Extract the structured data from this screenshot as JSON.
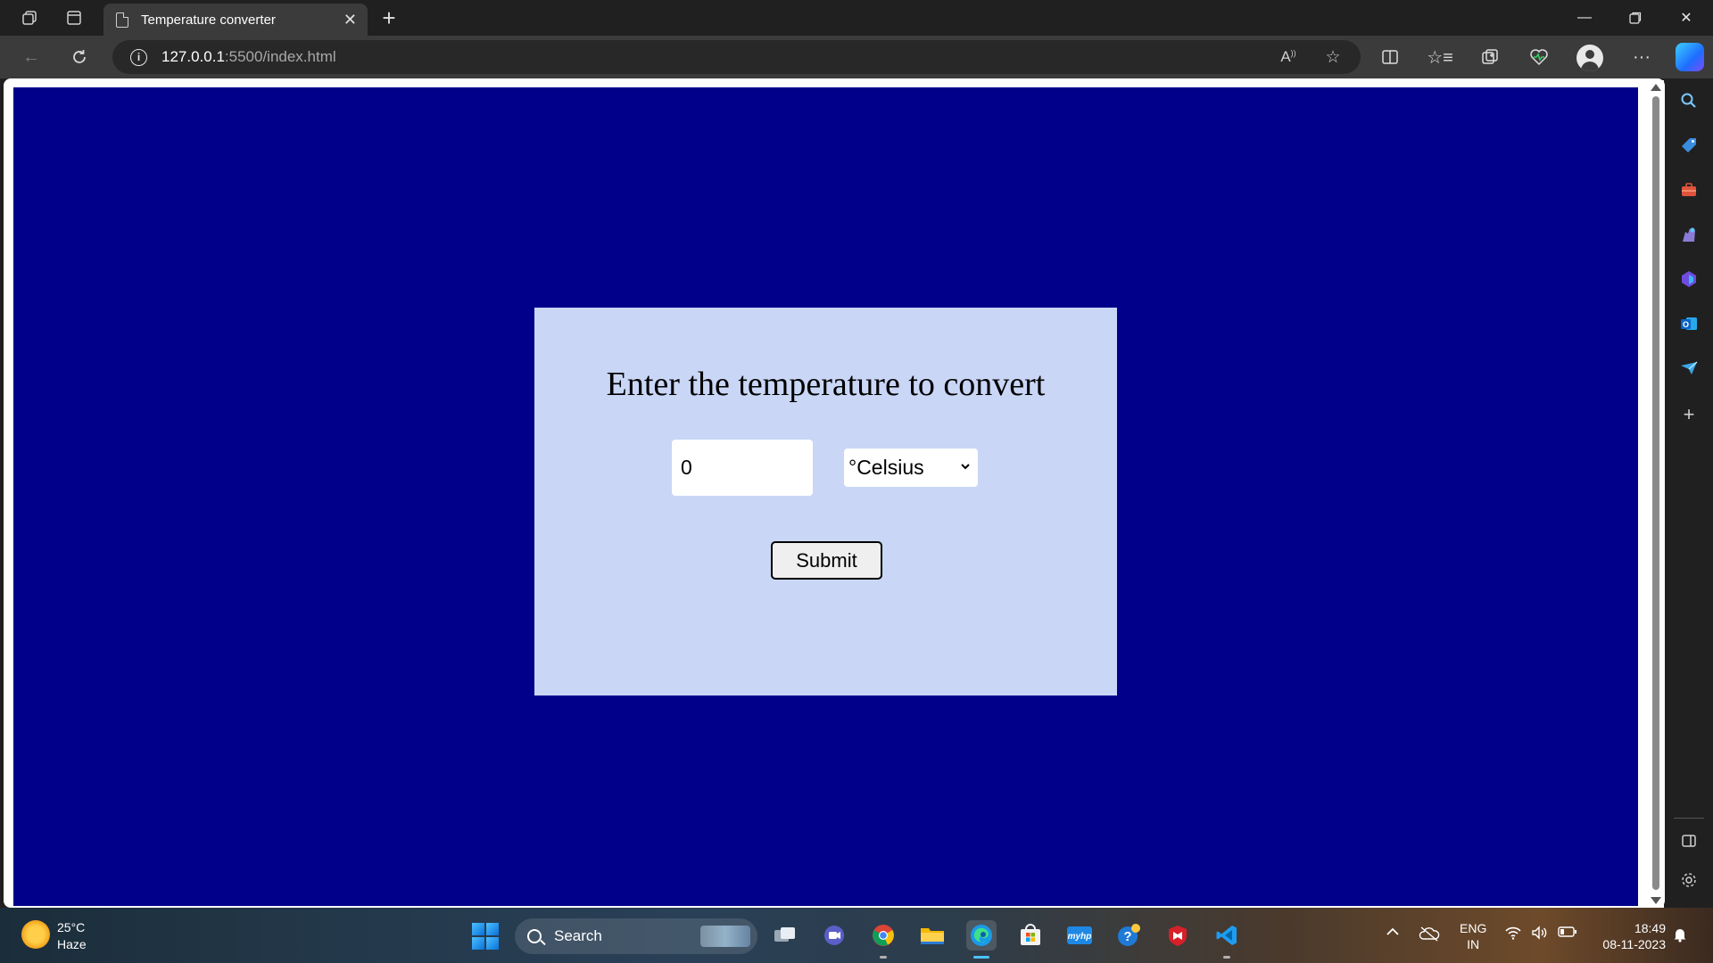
{
  "browser": {
    "tab_title": "Temperature converter",
    "url_host": "127.0.0.1",
    "url_path": ":5500/index.html",
    "colors": {
      "chrome": "#202020",
      "toolbar": "#3b3b3b"
    }
  },
  "page": {
    "heading": "Enter the temperature to convert",
    "temperature_value": "0",
    "unit_selected": "°Celsius",
    "submit_label": "Submit",
    "colors": {
      "background": "#00008b",
      "card": "#c9d6f6"
    }
  },
  "taskbar": {
    "weather_temp": "25°C",
    "weather_condition": "Haze",
    "search_label": "Search",
    "lang_line1": "ENG",
    "lang_line2": "IN",
    "time": "18:49",
    "date": "08-11-2023"
  },
  "icons": {
    "titlebar": [
      "workspaces-icon",
      "tab-actions-icon"
    ],
    "toolbar": [
      "back-icon",
      "refresh-icon",
      "info-icon",
      "read-aloud-icon",
      "favorite-star-icon",
      "split-screen-icon",
      "favorites-icon",
      "collections-icon",
      "browser-essentials-icon",
      "profile-icon",
      "more-icon",
      "copilot-icon"
    ],
    "sidebar": [
      "search-icon",
      "shopping-icon",
      "tools-icon",
      "games-icon",
      "microsoft365-icon",
      "outlook-icon",
      "drop-icon",
      "add-icon",
      "hide-sidebar-icon",
      "settings-icon"
    ]
  }
}
